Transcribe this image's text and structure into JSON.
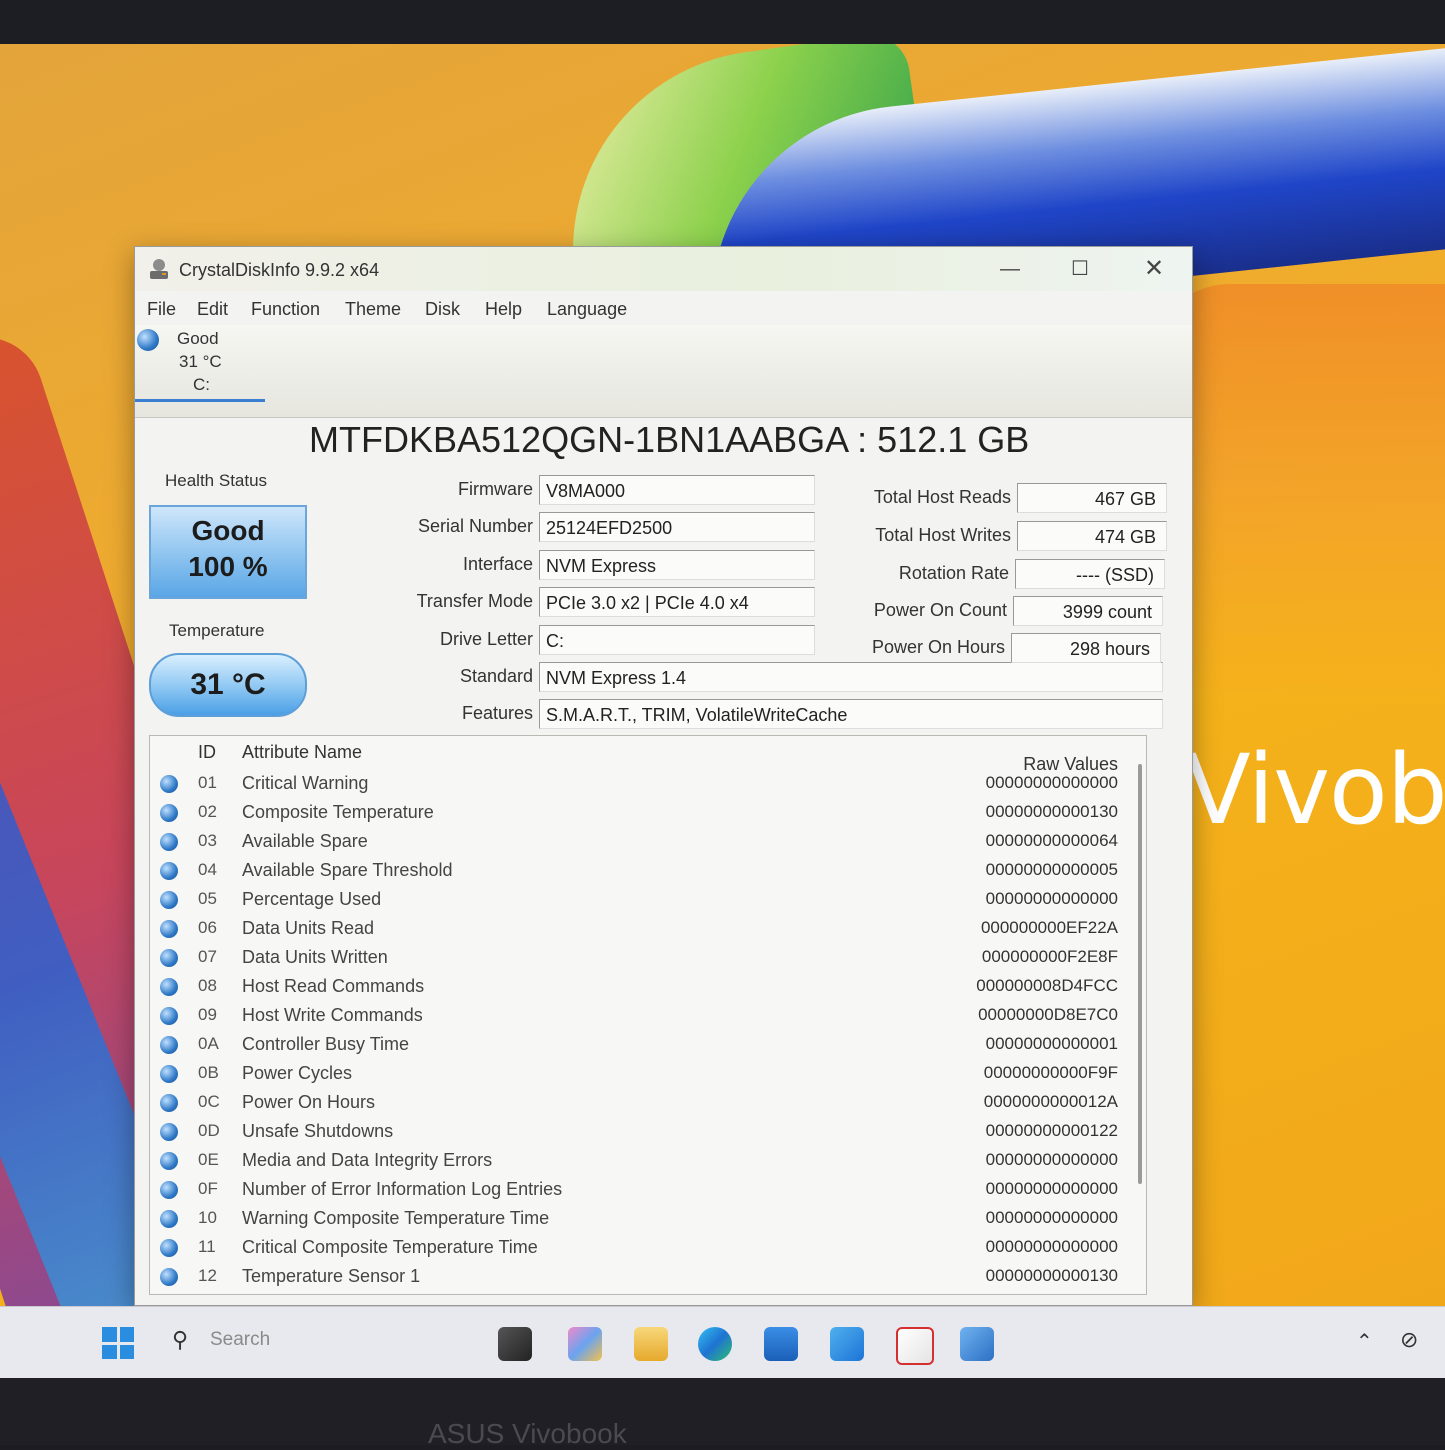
{
  "window": {
    "title": "CrystalDiskInfo 9.9.2 x64",
    "controls": {
      "minimize": "—",
      "maximize": "☐",
      "close": "✕"
    }
  },
  "menu": [
    "File",
    "Edit",
    "Function",
    "Theme",
    "Disk",
    "Help",
    "Language"
  ],
  "drive_tab": {
    "status": "Good",
    "temp": "31 °C",
    "letter": "C:"
  },
  "model_title": "MTFDKBA512QGN-1BN1AABGA : 512.1 GB",
  "health": {
    "label": "Health Status",
    "status": "Good",
    "percent": "100 %"
  },
  "temperature": {
    "label": "Temperature",
    "value": "31 °C"
  },
  "info_fields": [
    {
      "label": "Firmware",
      "value": "V8MA000"
    },
    {
      "label": "Serial Number",
      "value": "25124EFD2500"
    },
    {
      "label": "Interface",
      "value": "NVM Express"
    },
    {
      "label": "Transfer Mode",
      "value": "PCIe 3.0 x2 | PCIe 4.0 x4"
    },
    {
      "label": "Drive Letter",
      "value": "C:"
    },
    {
      "label": "Standard",
      "value": "NVM Express 1.4"
    },
    {
      "label": "Features",
      "value": "S.M.A.R.T., TRIM, VolatileWriteCache"
    }
  ],
  "right_fields": [
    {
      "label": "Total Host Reads",
      "value": "467 GB"
    },
    {
      "label": "Total Host Writes",
      "value": "474 GB"
    },
    {
      "label": "Rotation Rate",
      "value": "---- (SSD)"
    },
    {
      "label": "Power On Count",
      "value": "3999 count"
    },
    {
      "label": "Power On Hours",
      "value": "298 hours"
    }
  ],
  "table": {
    "headers": {
      "id": "ID",
      "name": "Attribute Name",
      "raw": "Raw Values"
    },
    "rows": [
      {
        "id": "01",
        "name": "Critical Warning",
        "raw": "00000000000000"
      },
      {
        "id": "02",
        "name": "Composite Temperature",
        "raw": "00000000000130"
      },
      {
        "id": "03",
        "name": "Available Spare",
        "raw": "00000000000064"
      },
      {
        "id": "04",
        "name": "Available Spare Threshold",
        "raw": "00000000000005"
      },
      {
        "id": "05",
        "name": "Percentage Used",
        "raw": "00000000000000"
      },
      {
        "id": "06",
        "name": "Data Units Read",
        "raw": "000000000EF22A"
      },
      {
        "id": "07",
        "name": "Data Units Written",
        "raw": "000000000F2E8F"
      },
      {
        "id": "08",
        "name": "Host Read Commands",
        "raw": "000000008D4FCC"
      },
      {
        "id": "09",
        "name": "Host Write Commands",
        "raw": "00000000D8E7C0"
      },
      {
        "id": "0A",
        "name": "Controller Busy Time",
        "raw": "00000000000001"
      },
      {
        "id": "0B",
        "name": "Power Cycles",
        "raw": "00000000000F9F"
      },
      {
        "id": "0C",
        "name": "Power On Hours",
        "raw": "0000000000012A"
      },
      {
        "id": "0D",
        "name": "Unsafe Shutdowns",
        "raw": "00000000000122"
      },
      {
        "id": "0E",
        "name": "Media and Data Integrity Errors",
        "raw": "00000000000000"
      },
      {
        "id": "0F",
        "name": "Number of Error Information Log Entries",
        "raw": "00000000000000"
      },
      {
        "id": "10",
        "name": "Warning Composite Temperature Time",
        "raw": "00000000000000"
      },
      {
        "id": "11",
        "name": "Critical Composite Temperature Time",
        "raw": "00000000000000"
      },
      {
        "id": "12",
        "name": "Temperature Sensor 1",
        "raw": "00000000000130"
      }
    ]
  },
  "taskbar": {
    "search_placeholder": "Search"
  },
  "wallpaper_brand": "Vivob",
  "bezel_brand": "ASUS Vivobook",
  "colors": {
    "good_blue": "#5aa6e6",
    "wallpaper_yellow": "#f5b21a"
  }
}
